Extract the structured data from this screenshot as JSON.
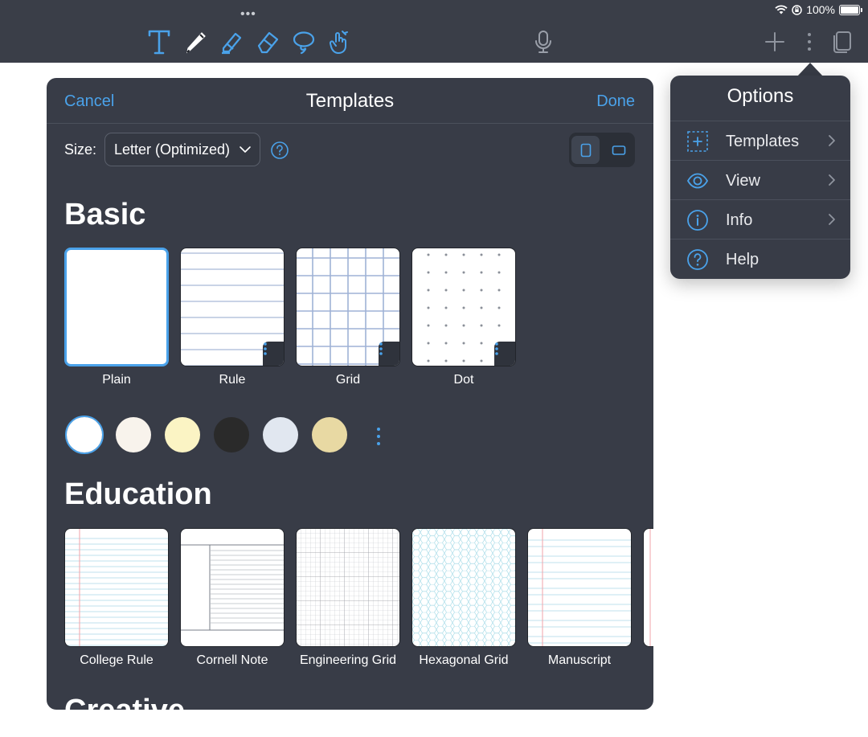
{
  "status": {
    "battery_text": "100%"
  },
  "toolbar": {
    "tools": [
      "text-tool",
      "pen-tool",
      "highlighter-tool",
      "eraser-tool",
      "lasso-tool",
      "hand-tool"
    ],
    "accent": "#4aa2ea"
  },
  "templates_panel": {
    "cancel_label": "Cancel",
    "title": "Templates",
    "done_label": "Done",
    "size_label": "Size:",
    "size_value": "Letter (Optimized)",
    "orientation_selected": "portrait",
    "basic": {
      "title": "Basic",
      "items": [
        {
          "label": "Plain",
          "selected": true
        },
        {
          "label": "Rule"
        },
        {
          "label": "Grid"
        },
        {
          "label": "Dot"
        }
      ]
    },
    "paper_colors": [
      "#ffffff",
      "#f8f3ec",
      "#fbf4c4",
      "#2a2a2a",
      "#e1e7f0",
      "#e8d9a3"
    ],
    "education": {
      "title": "Education",
      "items": [
        {
          "label": "College Rule"
        },
        {
          "label": "Cornell Note"
        },
        {
          "label": "Engineering Grid"
        },
        {
          "label": "Hexagonal Grid"
        },
        {
          "label": "Manuscript"
        }
      ]
    },
    "creative_title": "Creative"
  },
  "options_menu": {
    "title": "Options",
    "items": [
      {
        "label": "Templates",
        "icon": "template-icon",
        "has_chevron": true
      },
      {
        "label": "View",
        "icon": "eye-icon",
        "has_chevron": true
      },
      {
        "label": "Info",
        "icon": "info-icon",
        "has_chevron": true
      },
      {
        "label": "Help",
        "icon": "help-icon",
        "has_chevron": false
      }
    ]
  }
}
